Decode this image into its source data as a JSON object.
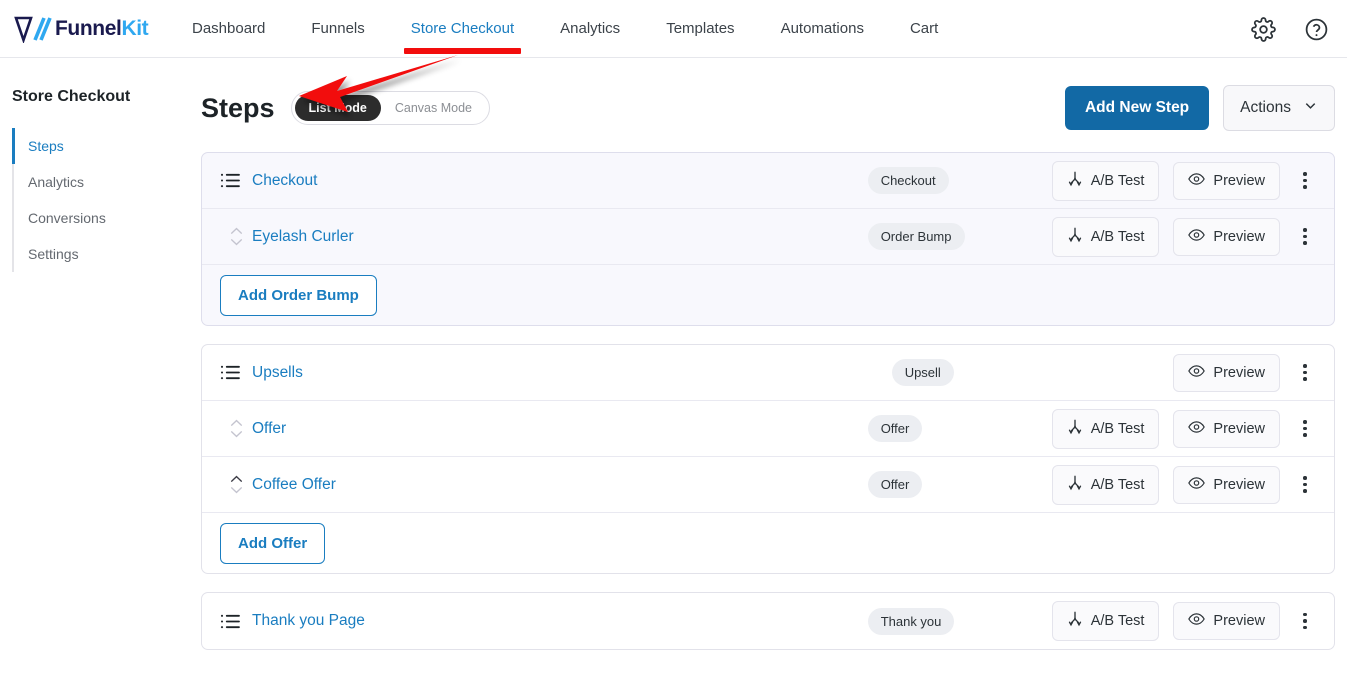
{
  "header": {
    "logo": {
      "part1": "Funnel",
      "part2": "Kit",
      "icon": "funnelkit-logo-icon"
    },
    "nav": [
      {
        "label": "Dashboard",
        "active": false
      },
      {
        "label": "Funnels",
        "active": false
      },
      {
        "label": "Store Checkout",
        "active": true
      },
      {
        "label": "Analytics",
        "active": false
      },
      {
        "label": "Templates",
        "active": false
      },
      {
        "label": "Automations",
        "active": false
      },
      {
        "label": "Cart",
        "active": false
      }
    ],
    "settings_icon": "gear-icon",
    "help_icon": "question-mark-circle-icon"
  },
  "sidebar": {
    "title": "Store Checkout",
    "items": [
      {
        "label": "Steps",
        "active": true
      },
      {
        "label": "Analytics",
        "active": false
      },
      {
        "label": "Conversions",
        "active": false
      },
      {
        "label": "Settings",
        "active": false
      }
    ]
  },
  "main": {
    "title": "Steps",
    "modes": [
      {
        "label": "List Mode",
        "active": true
      },
      {
        "label": "Canvas Mode",
        "active": false
      }
    ],
    "add_step_label": "Add New Step",
    "actions_label": "Actions",
    "actions_chevron": "chevron-down-icon"
  },
  "labels": {
    "ab_test": "A/B Test",
    "preview": "Preview",
    "ab_test_icon": "ab-split-test-icon",
    "preview_icon": "eye-icon",
    "menu_icon": "kebab-menu-icon",
    "list_icon": "list-lines-icon",
    "sorter_icon": "sort-up-down-icon"
  },
  "cards": [
    {
      "tinted": true,
      "rows": [
        {
          "icon": "list",
          "label": "Checkout",
          "badge": "Checkout",
          "ab_test": true,
          "preview": true,
          "menu": true
        },
        {
          "icon": "sorter",
          "label": "Eyelash Curler",
          "badge": "Order Bump",
          "ab_test": true,
          "preview": true,
          "menu": true
        }
      ],
      "footer_button": "Add Order Bump"
    },
    {
      "tinted": false,
      "rows": [
        {
          "icon": "list",
          "label": "Upsells",
          "badge": "Upsell",
          "ab_test": false,
          "preview": true,
          "menu": true
        },
        {
          "icon": "sorter",
          "label": "Offer",
          "badge": "Offer",
          "ab_test": true,
          "preview": true,
          "menu": true
        },
        {
          "icon": "sorter",
          "label": "Coffee Offer",
          "badge": "Offer",
          "ab_test": true,
          "preview": true,
          "menu": true,
          "sorter_active": true
        }
      ],
      "footer_button": "Add Offer"
    },
    {
      "tinted": false,
      "rows": [
        {
          "icon": "list",
          "label": "Thank you Page",
          "badge": "Thank you",
          "ab_test": true,
          "preview": true,
          "menu": true
        }
      ],
      "footer_button": null
    }
  ],
  "annotation": {
    "arrow_color": "#f20d0d",
    "points_to": "Checkout",
    "name": "red-arrow-annotation"
  },
  "colors": {
    "accent_blue": "#1a7dc0",
    "primary_button": "#1269a5",
    "logo_dark": "#1a1a4e",
    "logo_light": "#2fa8f0",
    "annotation_red": "#f20d0d",
    "tinted_card": "#f8f8fd"
  }
}
